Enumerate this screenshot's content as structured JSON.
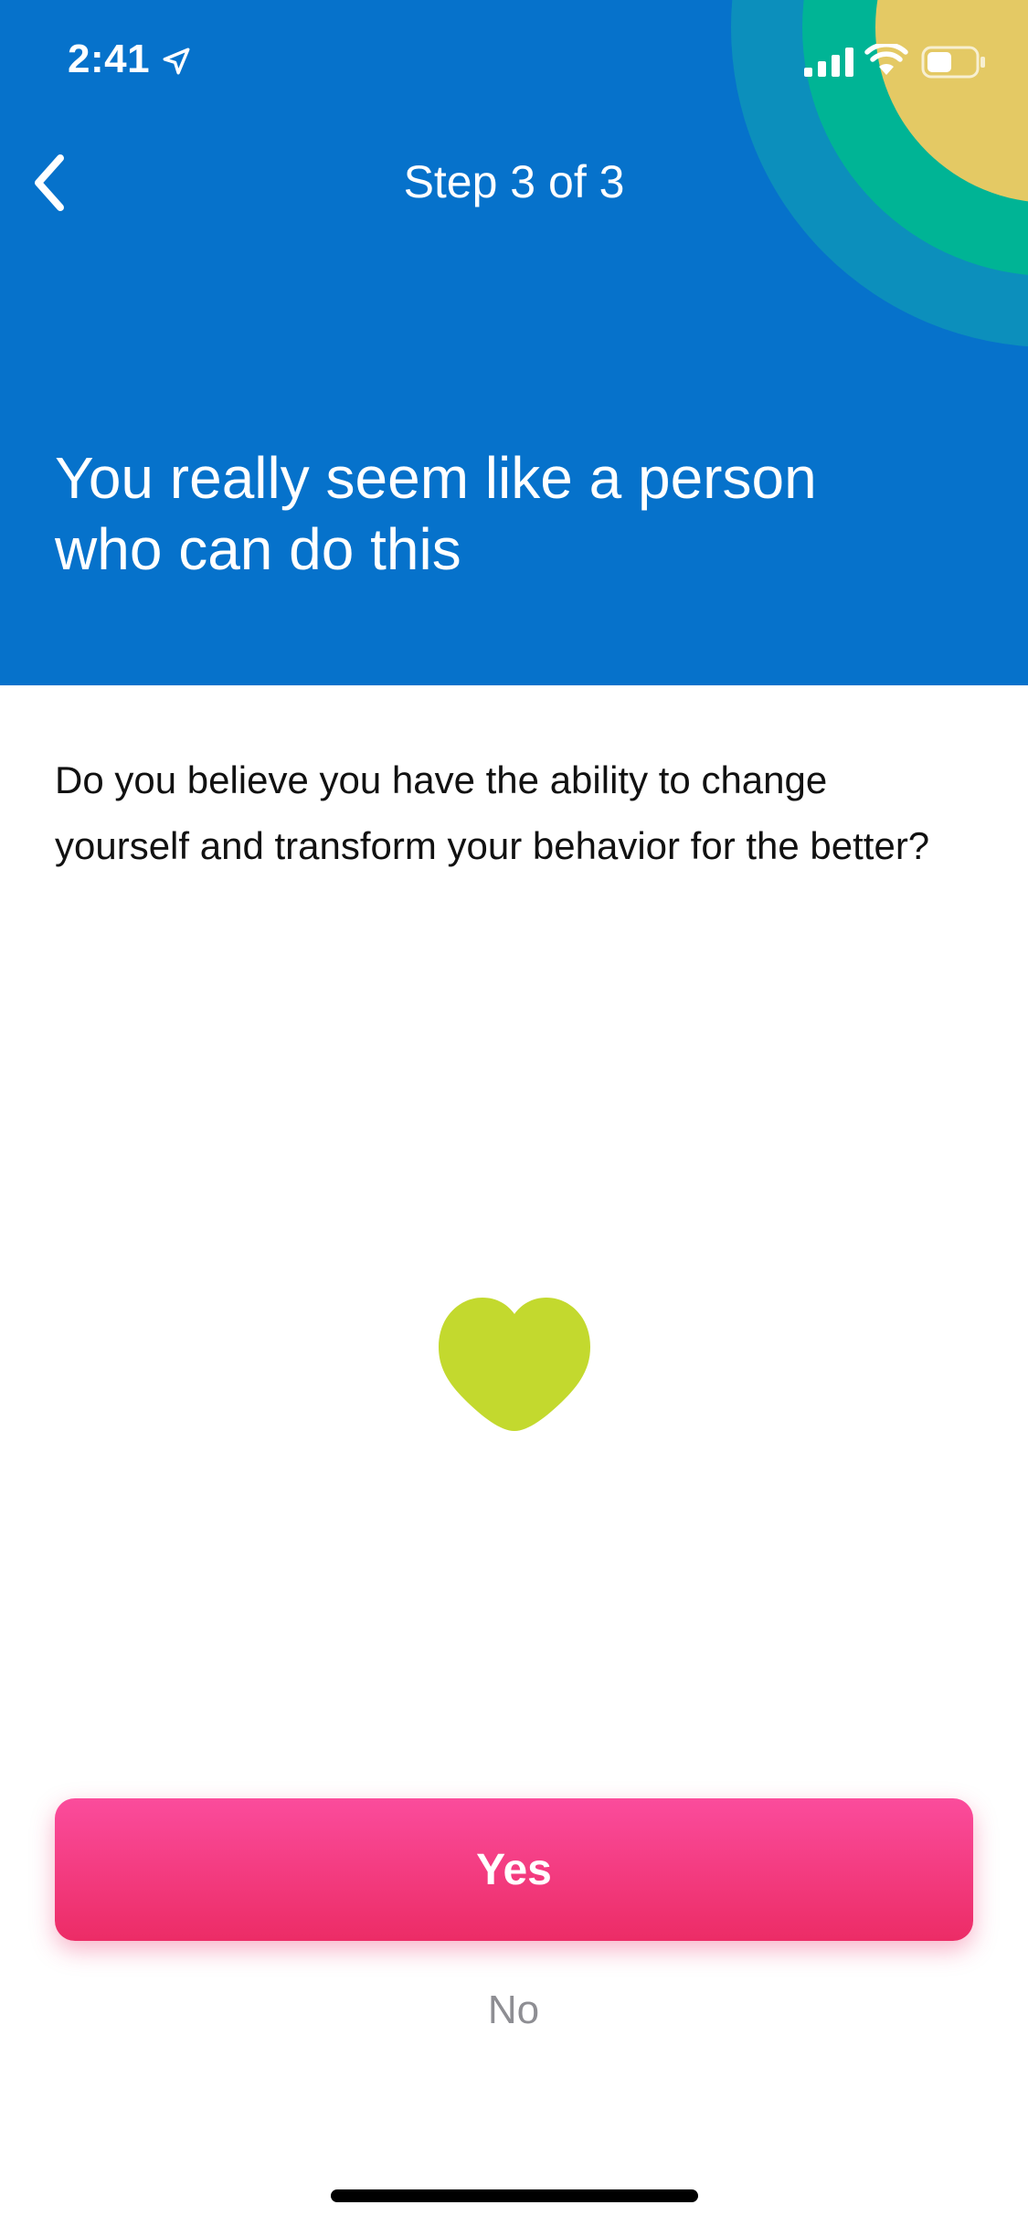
{
  "status_bar": {
    "time": "2:41",
    "location_icon": "location-arrow-icon",
    "signal_icon": "cellular-signal-icon",
    "wifi_icon": "wifi-icon",
    "battery_icon": "battery-icon"
  },
  "nav": {
    "back_icon": "chevron-left-icon",
    "title": "Step 3 of 3"
  },
  "header": {
    "headline": "You really seem like a person who can do this"
  },
  "body": {
    "question": "Do you believe you have the ability to change yourself and transform your behavior for the better?",
    "illustration_icon": "heart-icon"
  },
  "actions": {
    "yes_label": "Yes",
    "no_label": "No"
  },
  "colors": {
    "header_blue": "#0672cb",
    "ring_teal": "#0c8fbc",
    "ring_green": "#00b495",
    "ring_yellow": "#e4c964",
    "heart_green": "#c3d92e",
    "yes_pink": "#f03f7e",
    "no_gray": "#8e8e93"
  }
}
